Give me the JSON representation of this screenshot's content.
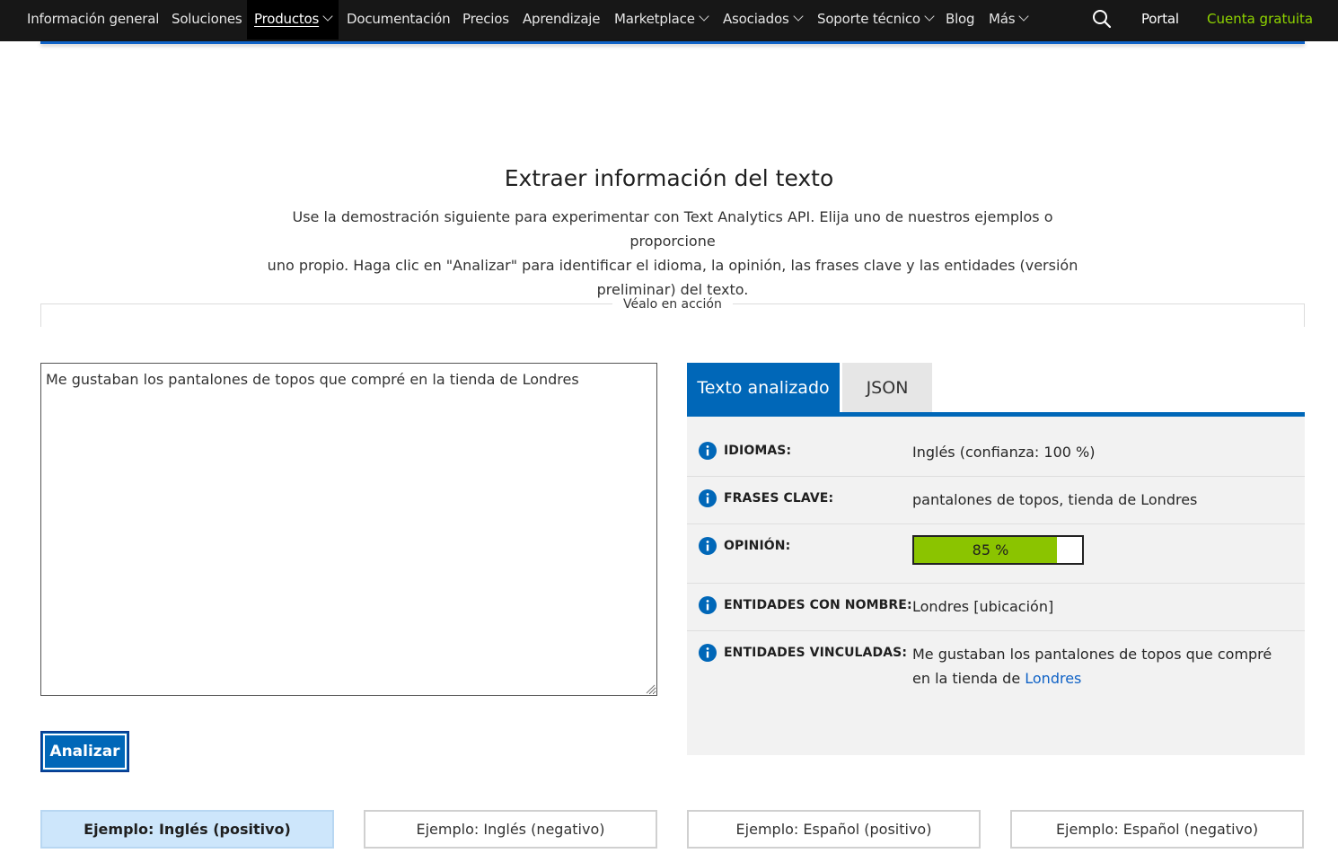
{
  "nav": {
    "items": [
      {
        "label": "Información general",
        "dropdown": false
      },
      {
        "label": "Soluciones",
        "dropdown": false
      },
      {
        "label": "Productos",
        "dropdown": true,
        "active": true
      },
      {
        "label": "Documentación",
        "dropdown": false
      },
      {
        "label": "Precios",
        "dropdown": false
      },
      {
        "label": "Aprendizaje",
        "dropdown": false
      },
      {
        "label": "Marketplace",
        "dropdown": true
      },
      {
        "label": "Asociados",
        "dropdown": true
      },
      {
        "label": "Soporte técnico",
        "dropdown": true
      },
      {
        "label": "Blog",
        "dropdown": false
      },
      {
        "label": "Más",
        "dropdown": true
      }
    ],
    "search_icon": "search-icon",
    "portal": "Portal",
    "free_account": "Cuenta gratuita"
  },
  "main": {
    "title": "Extraer información del texto",
    "intro_lines": [
      "Use la demostración siguiente para experimentar con Text Analytics API. Elija uno de nuestros ejemplos o proporcione",
      "uno propio. Haga clic en \"Analizar\" para identificar el idioma, la opinión, las frases clave y las entidades (versión",
      "preliminar) del texto."
    ],
    "section_label": "Véalo en acción"
  },
  "demo": {
    "input_text": "Me gustaban los pantalones de topos que compré en la tienda de Londres",
    "analyze_label": "Analizar"
  },
  "results": {
    "tabs": {
      "analyzed": "Texto analizado",
      "json": "JSON"
    },
    "languages": {
      "label": "IDIOMAS:",
      "value": "Inglés (confianza: 100 %)"
    },
    "key_phrases": {
      "label": "FRASES CLAVE:",
      "value": "pantalones de topos, tienda de Londres"
    },
    "sentiment": {
      "label": "OPINIÓN:",
      "text": "85 %",
      "score": 0.85
    },
    "named_entities": {
      "label": "ENTIDADES CON NOMBRE:",
      "value": "Londres [ubicación]"
    },
    "linked_entities": {
      "label": "ENTIDADES VINCULADAS:",
      "line1": "Me gustaban los pantalones de topos que compré",
      "line2_prefix": "en la tienda de ",
      "line2_link": "Londres"
    }
  },
  "examples": [
    {
      "label": "Ejemplo: Inglés (positivo)",
      "selected": true
    },
    {
      "label": "Ejemplo: Inglés (negativo)",
      "selected": false
    },
    {
      "label": "Ejemplo: Español (positivo)",
      "selected": false
    },
    {
      "label": "Ejemplo: Español (negativo)",
      "selected": false
    }
  ],
  "colors": {
    "nav_bg": "#171717",
    "accent_green": "#8fd400",
    "primary_blue": "#0067b8",
    "sentiment_fill": "#8bc400",
    "selected_example_bg": "#cde6fb"
  }
}
